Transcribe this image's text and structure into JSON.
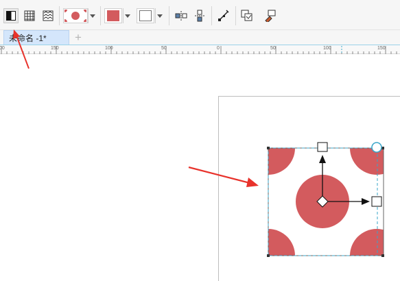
{
  "toolbar": {
    "buttons": [
      {
        "name": "transparency-split-icon"
      },
      {
        "name": "grid-pattern-icon"
      },
      {
        "name": "pattern-fill-icon"
      },
      {
        "name": "pattern-preview-dropdown"
      },
      {
        "name": "fill-color-dropdown",
        "color": "#d35b5e"
      },
      {
        "name": "outline-color-dropdown",
        "color": "#ffffff"
      },
      {
        "name": "mirror-horizontal-icon"
      },
      {
        "name": "mirror-vertical-icon"
      },
      {
        "name": "edit-node-icon"
      },
      {
        "name": "copy-properties-icon"
      },
      {
        "name": "apply-fill-icon"
      }
    ]
  },
  "tabs": [
    {
      "label": "未命名 -1*",
      "active": true
    }
  ],
  "add_tab_symbol": "+",
  "ruler": {
    "labels": [
      "00",
      "150",
      "100",
      "50",
      "0",
      "50",
      "100",
      "150"
    ]
  },
  "canvas": {
    "pattern_color": "#d35b5e",
    "guide_color": "#3aa6c9",
    "annotation_color": "#e8322b"
  }
}
